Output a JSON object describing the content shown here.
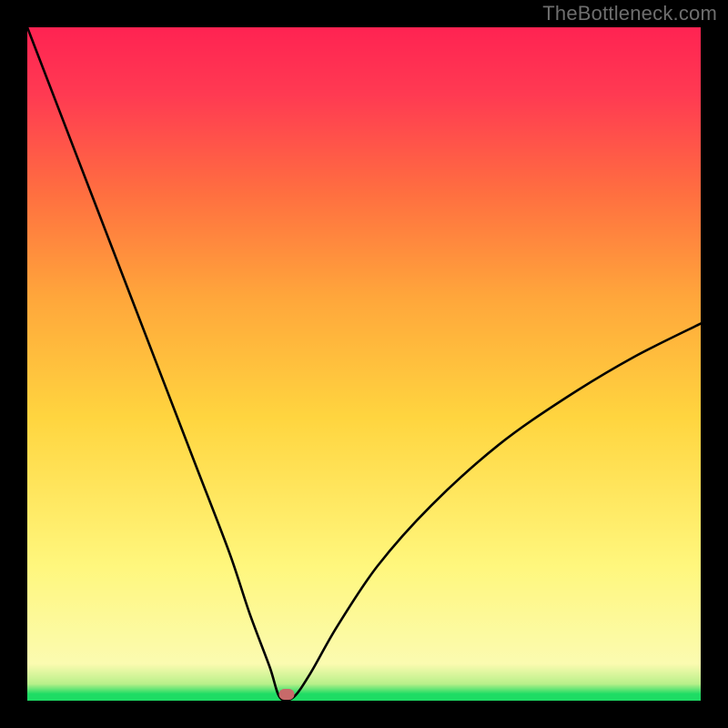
{
  "watermark": "TheBottleneck.com",
  "chart_data": {
    "type": "line",
    "title": "",
    "xlabel": "",
    "ylabel": "",
    "xlim": [
      0,
      100
    ],
    "ylim": [
      0,
      100
    ],
    "grid": false,
    "curve": {
      "description": "V-shaped bottleneck curve: high on left, dips to zero near x≈38, rises back toward ~55 on right",
      "x": [
        0,
        5,
        10,
        15,
        20,
        25,
        30,
        33,
        36,
        37.5,
        39.5,
        42,
        46,
        52,
        60,
        70,
        80,
        90,
        100
      ],
      "y": [
        100,
        87,
        74,
        61,
        48,
        35,
        22,
        13,
        5,
        0.5,
        0.5,
        4,
        11,
        20,
        29,
        38,
        45,
        51,
        56
      ]
    },
    "marker": {
      "x": 38.5,
      "y": 0.9
    },
    "background_gradient_stops": [
      {
        "pos": 0.0,
        "color": "#1edc64"
      },
      {
        "pos": 0.055,
        "color": "#fbfbb0"
      },
      {
        "pos": 0.2,
        "color": "#fff77d"
      },
      {
        "pos": 0.6,
        "color": "#ffa63b"
      },
      {
        "pos": 1.0,
        "color": "#ff2352"
      }
    ]
  }
}
